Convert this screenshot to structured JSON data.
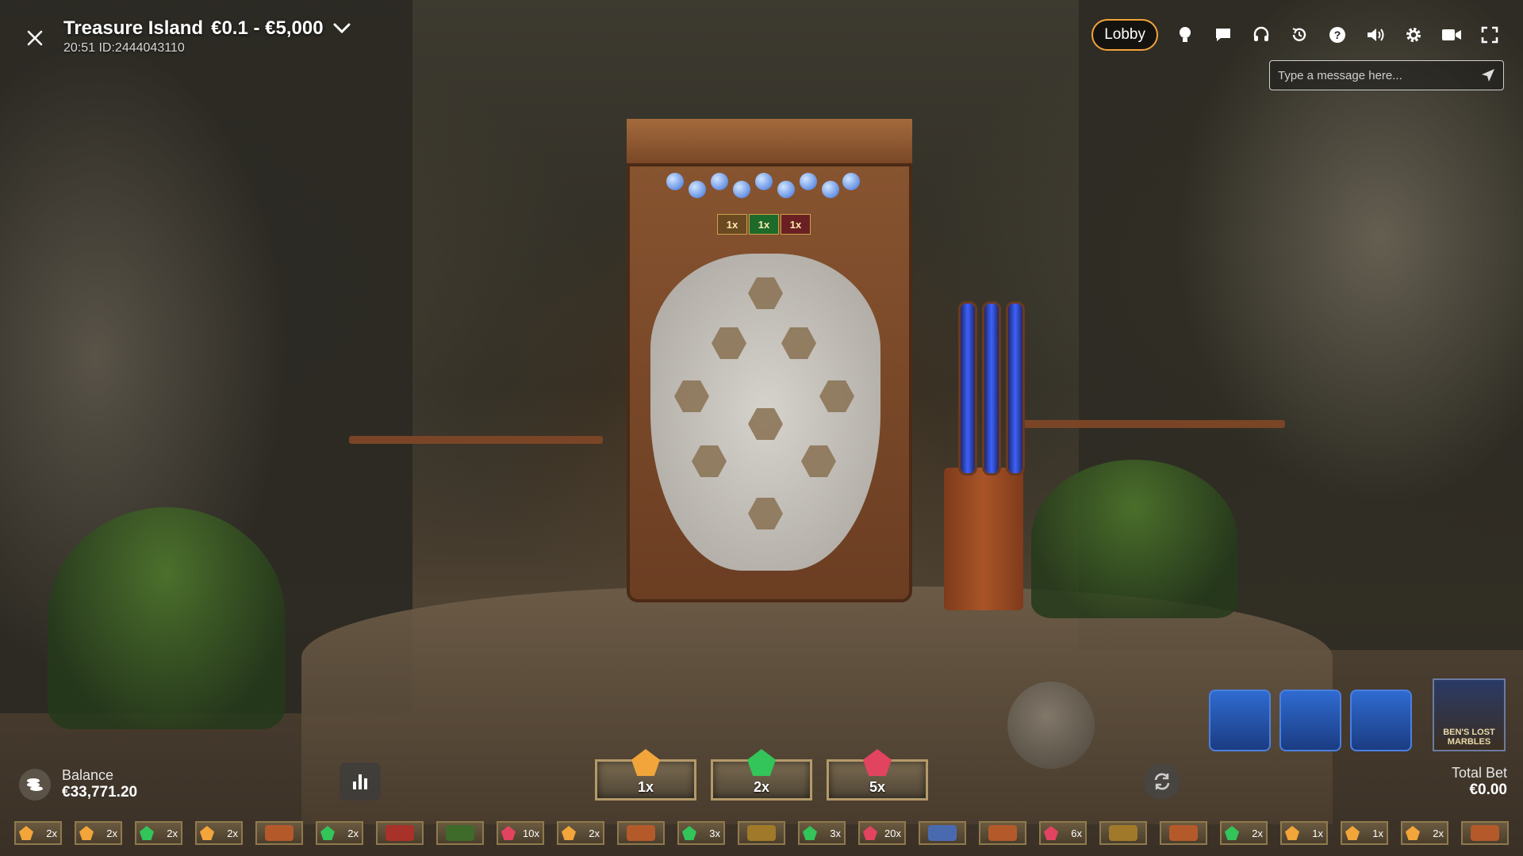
{
  "header": {
    "title": "Treasure Island",
    "limits": "€0.1 - €5,000",
    "round_info": "20:51 ID:2444043110"
  },
  "toolbar": {
    "lobby_label": "Lobby",
    "icons": [
      "bulb-icon",
      "chat-icon",
      "headset-icon",
      "history-icon",
      "help-icon",
      "volume-icon",
      "gear-icon",
      "video-icon",
      "fullscreen-icon"
    ]
  },
  "chat": {
    "placeholder": "Type a message here..."
  },
  "board": {
    "multipliers": [
      "1x",
      "1x",
      "1x"
    ]
  },
  "balance": {
    "label": "Balance",
    "value": "€33,771.20"
  },
  "bet_spots": [
    {
      "mult": "1x",
      "color": "#f2a53a"
    },
    {
      "mult": "2x",
      "color": "#33c45a"
    },
    {
      "mult": "5x",
      "color": "#e2445f"
    }
  ],
  "total_bet": {
    "label": "Total Bet",
    "value": "€0.00"
  },
  "brand": {
    "logo_text": "BEN'S LOST MARBLES"
  },
  "history": [
    {
      "mult": "2x",
      "kind": "orange"
    },
    {
      "mult": "2x",
      "kind": "orange"
    },
    {
      "mult": "2x",
      "kind": "green"
    },
    {
      "mult": "2x",
      "kind": "orange"
    },
    {
      "mult": "",
      "kind": "skull"
    },
    {
      "mult": "2x",
      "kind": "green"
    },
    {
      "mult": "",
      "kind": "chest"
    },
    {
      "mult": "",
      "kind": "wheel"
    },
    {
      "mult": "10x",
      "kind": "pink"
    },
    {
      "mult": "2x",
      "kind": "orange"
    },
    {
      "mult": "",
      "kind": "skull"
    },
    {
      "mult": "3x",
      "kind": "green"
    },
    {
      "mult": "",
      "kind": "gold"
    },
    {
      "mult": "3x",
      "kind": "green"
    },
    {
      "mult": "20x",
      "kind": "pink"
    },
    {
      "mult": "",
      "kind": "map"
    },
    {
      "mult": "",
      "kind": "skull"
    },
    {
      "mult": "6x",
      "kind": "pink"
    },
    {
      "mult": "",
      "kind": "gold"
    },
    {
      "mult": "",
      "kind": "skull"
    },
    {
      "mult": "2x",
      "kind": "green"
    },
    {
      "mult": "1x",
      "kind": "orange"
    },
    {
      "mult": "1x",
      "kind": "orange"
    },
    {
      "mult": "2x",
      "kind": "orange"
    },
    {
      "mult": "",
      "kind": "skull"
    }
  ],
  "colors": {
    "accent": "#f3a43a",
    "orange_gem": "#f2a53a",
    "green_gem": "#33c45a",
    "pink_gem": "#e2445f",
    "tube_blue": "#2f6bd0"
  }
}
